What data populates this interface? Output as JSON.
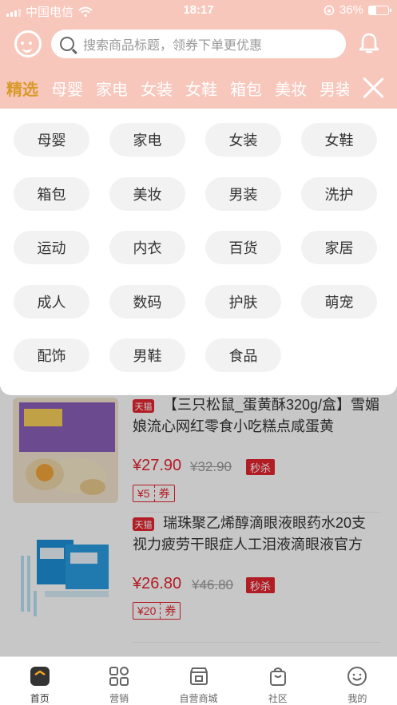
{
  "status_bar": {
    "carrier": "中国电信",
    "time": "18:17",
    "battery": "36%",
    "battery_level": 0.36
  },
  "search": {
    "placeholder": "搜索商品标题，领券下单更优惠"
  },
  "category_tabs": [
    "精选",
    "母婴",
    "家电",
    "女装",
    "女鞋",
    "箱包",
    "美妆",
    "男装"
  ],
  "category_chips": [
    "母婴",
    "家电",
    "女装",
    "女鞋",
    "箱包",
    "美妆",
    "男装",
    "洗护",
    "运动",
    "内衣",
    "百货",
    "家居",
    "成人",
    "数码",
    "护肤",
    "萌宠",
    "配饰",
    "男鞋",
    "食品"
  ],
  "products": [
    {
      "badge": "天猫",
      "title": "【三只松鼠_蛋黄酥320g/盒】雪媚娘流心网红零食小吃糕点咸蛋黄",
      "price": "¥27.90",
      "old_price": "¥32.90",
      "flash_label": "秒杀",
      "coupon_amount": "¥5",
      "coupon_unit": "券"
    },
    {
      "badge": "天猫",
      "title": "瑞珠聚乙烯醇滴眼液眼药水20支视力疲劳干眼症人工泪液滴眼液官方",
      "price": "¥26.80",
      "old_price": "¥46.80",
      "flash_label": "秒杀",
      "coupon_amount": "¥20",
      "coupon_unit": "券"
    }
  ],
  "bottom_nav": [
    {
      "label": "首页",
      "icon": "home-icon"
    },
    {
      "label": "营销",
      "icon": "grid-icon"
    },
    {
      "label": "自营商城",
      "icon": "store-icon"
    },
    {
      "label": "社区",
      "icon": "community-icon"
    },
    {
      "label": "我的",
      "icon": "profile-icon"
    }
  ],
  "colors": {
    "header_bg": "#f8c7bc",
    "accent_red": "#e5252f",
    "active_tab": "#d99a2b"
  }
}
